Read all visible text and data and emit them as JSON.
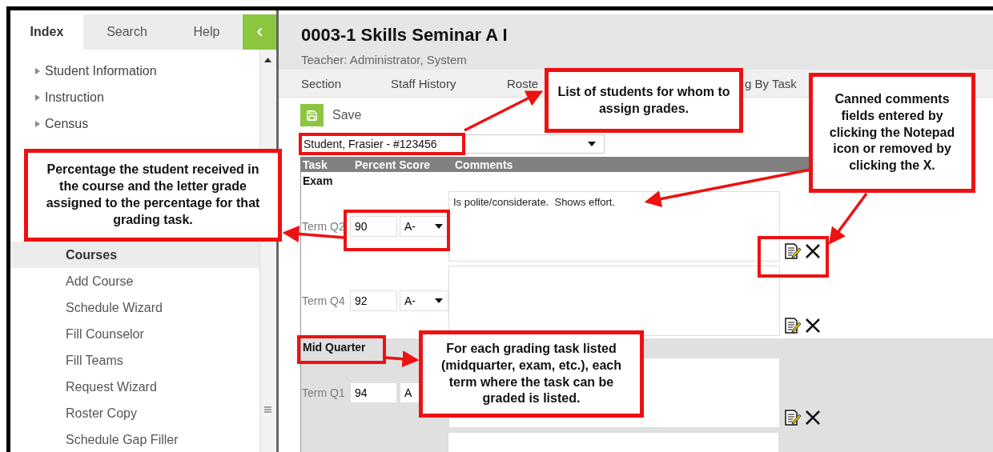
{
  "sidebar": {
    "tabs": [
      {
        "label": "Index",
        "selected": true
      },
      {
        "label": "Search",
        "selected": false
      },
      {
        "label": "Help",
        "selected": false
      }
    ],
    "tree": [
      {
        "label": "Student Information",
        "expanded": false
      },
      {
        "label": "Instruction",
        "expanded": false
      },
      {
        "label": "Census",
        "expanded": false
      }
    ],
    "sub_items": [
      {
        "label": "Courses",
        "selected": true
      },
      {
        "label": "Add Course",
        "selected": false
      },
      {
        "label": "Schedule Wizard",
        "selected": false
      },
      {
        "label": "Fill Counselor",
        "selected": false
      },
      {
        "label": "Fill Teams",
        "selected": false
      },
      {
        "label": "Request Wizard",
        "selected": false
      },
      {
        "label": "Roster Copy",
        "selected": false
      },
      {
        "label": "Schedule Gap Filler",
        "selected": false
      }
    ]
  },
  "header": {
    "title": "0003-1 Skills Seminar A I",
    "teacher": "Teacher: Administrator, System"
  },
  "tabs": [
    "Section",
    "Staff History",
    "Roste",
    "g By Task"
  ],
  "toolbar": {
    "save": "Save"
  },
  "student_select": {
    "value": "Student, Frasier - #123456"
  },
  "grid": {
    "columns": [
      "Task",
      "Percent Score",
      "Comments"
    ],
    "tasks": [
      {
        "name": "Exam",
        "cut_off": false,
        "terms": [
          {
            "term": "Term Q2",
            "percent": "90",
            "grade": "A-",
            "comment": "Is polite/considerate.  Shows effort."
          },
          {
            "term": "Term Q4",
            "percent": "92",
            "grade": "A-"
          }
        ]
      },
      {
        "name": "Mid Quarter",
        "cut_off": true,
        "terms": [
          {
            "term": "Term Q1",
            "percent": "94",
            "grade": "A"
          }
        ]
      }
    ]
  },
  "callouts": [
    "Percentage the student received in the course and the letter grade assigned to the percentage for that grading task.",
    "List of students for whom to assign grades.",
    "Canned comments fields entered by clicking the Notepad icon or removed by clicking the X.",
    "For each grading task listed (midquarter, exam, etc.), each term where the task can be graded is listed."
  ]
}
